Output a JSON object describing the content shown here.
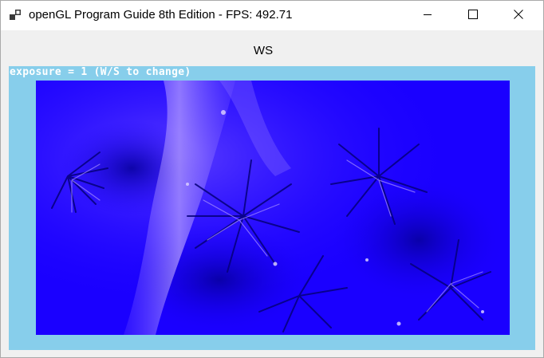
{
  "window": {
    "title": "openGL Program Guide 8th Edition - FPS: 492.71",
    "app_icon": "app-window-icon",
    "controls": {
      "minimize_icon": "minimize-icon",
      "maximize_icon": "maximize-icon",
      "close_icon": "close-icon"
    }
  },
  "client": {
    "label": "WS",
    "overlay_text": "exposure = 1 (W/S to change)",
    "render_description_icon": "rendered-hdr-image",
    "colors": {
      "frame_background": "#87ceeb",
      "image_base": "#1a00ff",
      "overlay_text": "#ffffff"
    }
  }
}
